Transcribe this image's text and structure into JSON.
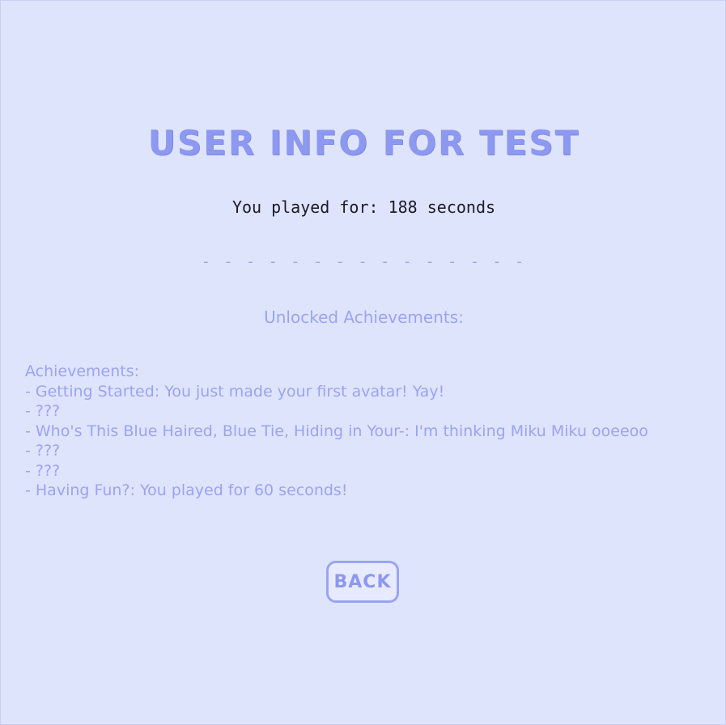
{
  "header": {
    "title": "USER INFO FOR TEST"
  },
  "stats": {
    "played_text": "You played for: 188 seconds"
  },
  "divider": {
    "text": "- - - - - - - - - - - - - - -"
  },
  "unlocked": {
    "heading": "Unlocked Achievements:"
  },
  "achievements": {
    "heading": "Achievements:",
    "items": [
      "- Getting Started: You just made your first avatar! Yay!",
      "- ???",
      "- Who's This Blue Haired, Blue Tie, Hiding in Your-: I'm thinking Miku Miku ooeeoo",
      "- ???",
      "- ???",
      "- Having Fun?: You played for 60 seconds!"
    ]
  },
  "buttons": {
    "back_label": "BACK"
  },
  "colors": {
    "background": "#dfe4fd",
    "accent": "#8d98f0",
    "text_dark": "#1a1a2a"
  }
}
